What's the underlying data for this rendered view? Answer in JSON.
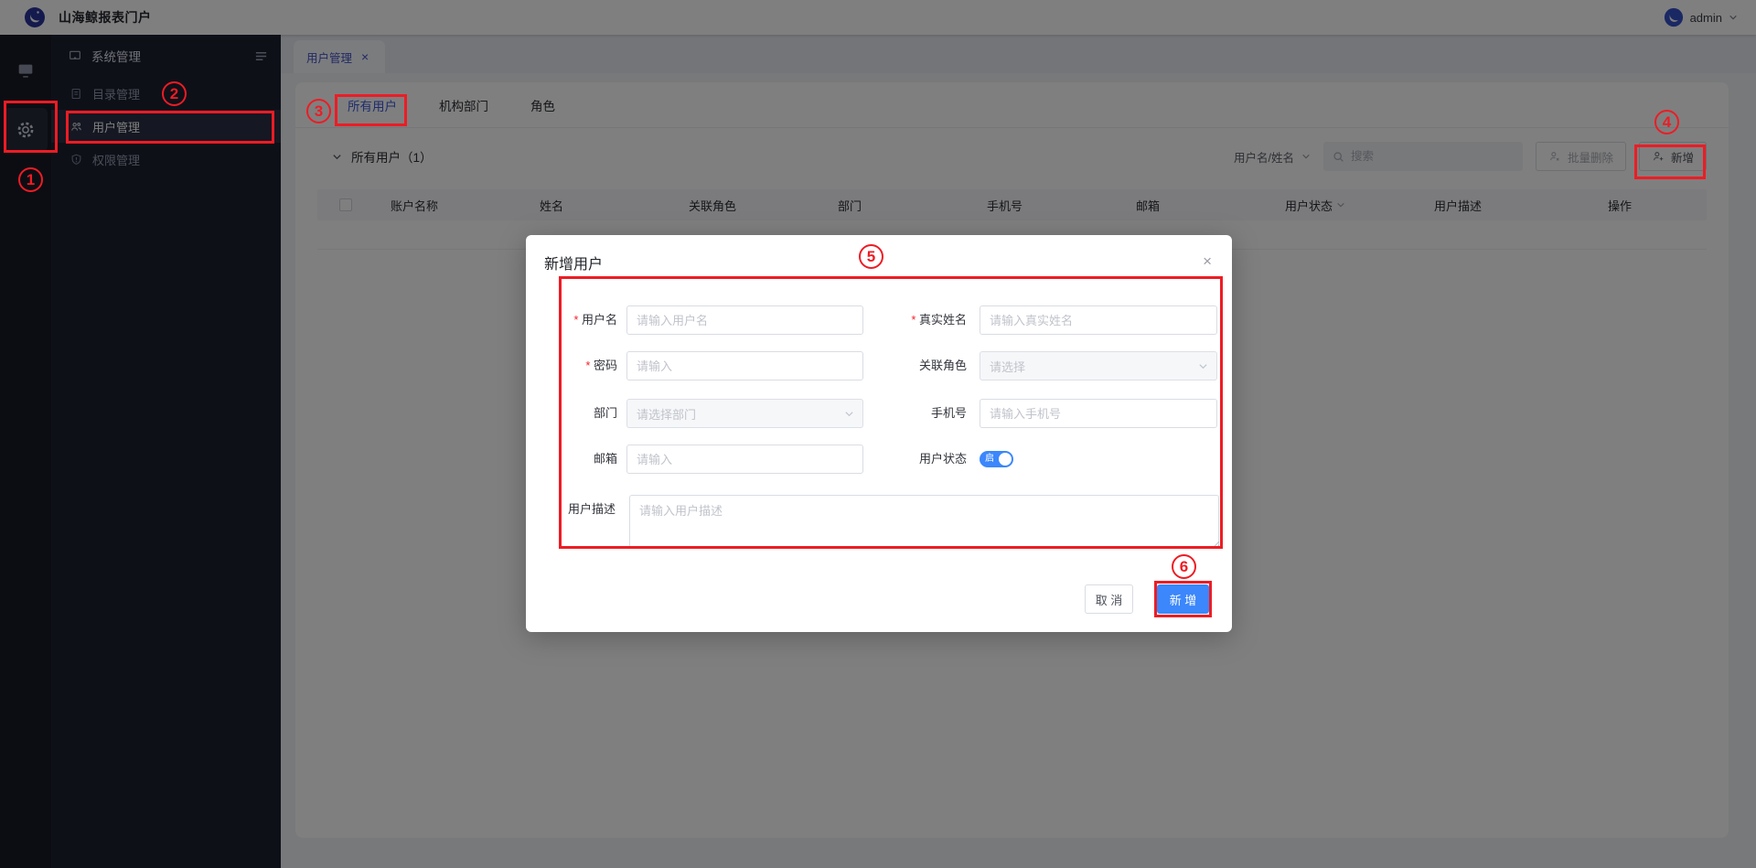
{
  "app": {
    "title": "山海鲸报表门户",
    "user": "admin"
  },
  "sidebar": {
    "header": "系统管理",
    "items": [
      {
        "label": "目录管理"
      },
      {
        "label": "用户管理"
      },
      {
        "label": "权限管理"
      }
    ]
  },
  "tabstrip": {
    "active_tab": "用户管理",
    "close": "×"
  },
  "content": {
    "tabs": [
      {
        "label": "所有用户"
      },
      {
        "label": "机构部门"
      },
      {
        "label": "角色"
      }
    ],
    "section_title": "所有用户（1）",
    "filter_field": "用户名/姓名",
    "search_placeholder": "搜索",
    "bulk_delete_label": "批量删除",
    "add_label": "新增",
    "columns": [
      "账户名称",
      "姓名",
      "关联角色",
      "部门",
      "手机号",
      "邮箱",
      "用户状态",
      "用户描述",
      "操作"
    ]
  },
  "modal": {
    "title": "新增用户",
    "close": "×",
    "fields": {
      "username": {
        "label": "用户名",
        "placeholder": "请输入用户名"
      },
      "realname": {
        "label": "真实姓名",
        "placeholder": "请输入真实姓名"
      },
      "password": {
        "label": "密码",
        "placeholder": "请输入"
      },
      "role": {
        "label": "关联角色",
        "placeholder": "请选择"
      },
      "department": {
        "label": "部门",
        "placeholder": "请选择部门"
      },
      "phone": {
        "label": "手机号",
        "placeholder": "请输入手机号"
      },
      "email": {
        "label": "邮箱",
        "placeholder": "请输入"
      },
      "status": {
        "label": "用户状态",
        "on_text": "启"
      },
      "description": {
        "label": "用户描述",
        "placeholder": "请输入用户描述"
      }
    },
    "cancel_label": "取 消",
    "submit_label": "新 增"
  },
  "annotations": {
    "labels": [
      "1",
      "2",
      "3",
      "4",
      "5",
      "6"
    ]
  },
  "colors": {
    "primary_blue": "#3b87fb",
    "tab_blue": "#3f58dc",
    "annotation_red": "#ed1c24",
    "sidebar_bg": "#1d2130",
    "rail_bg": "#191b26"
  }
}
